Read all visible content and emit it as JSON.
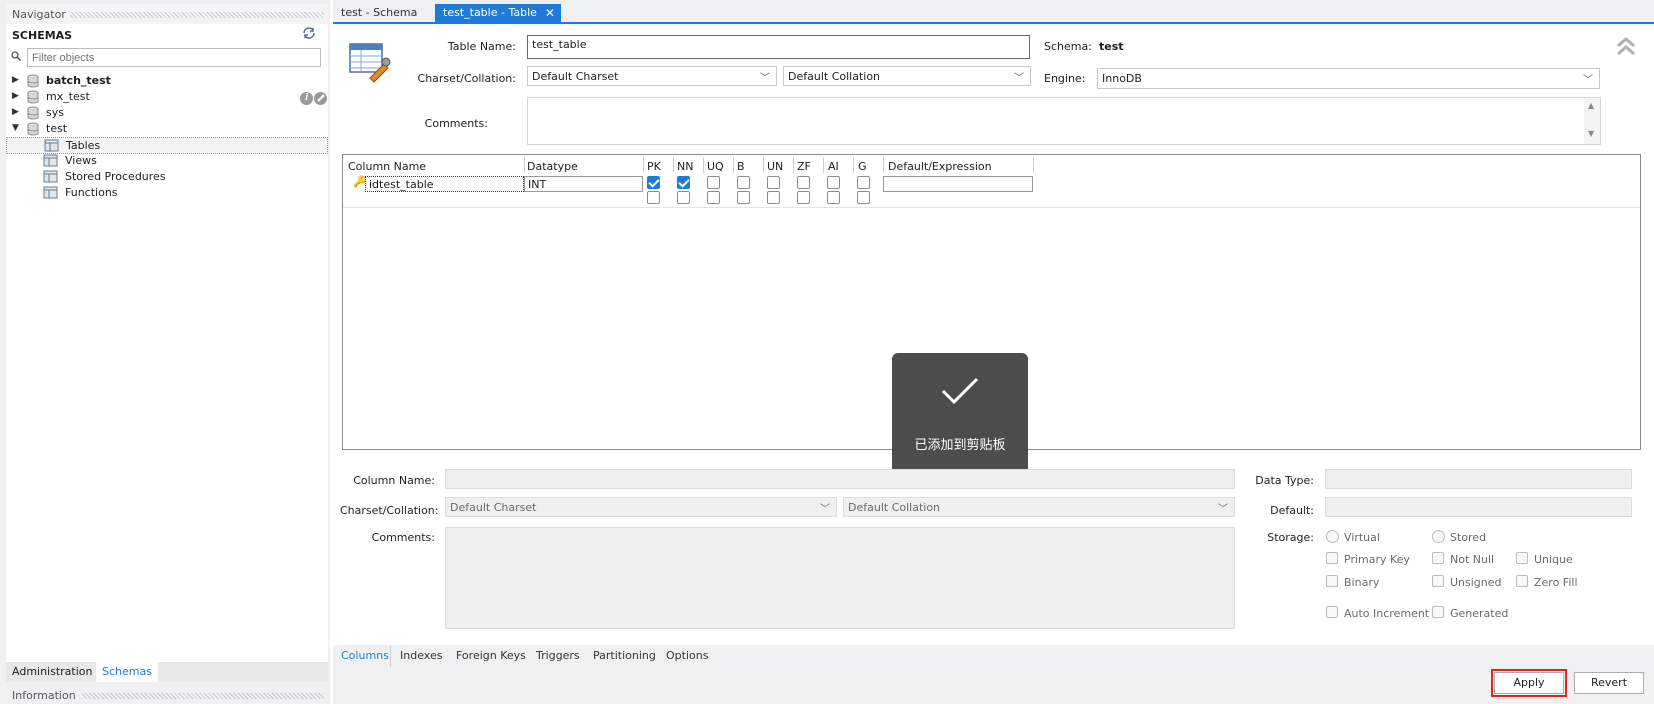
{
  "navigator": {
    "title": "Navigator",
    "schemas_header": "SCHEMAS",
    "filter_placeholder": "Filter objects",
    "schemas": [
      {
        "name": "batch_test"
      },
      {
        "name": "mx_test"
      },
      {
        "name": "sys"
      },
      {
        "name": "test"
      }
    ],
    "test_children": [
      "Tables",
      "Views",
      "Stored Procedures",
      "Functions"
    ],
    "tabs": [
      "Administration",
      "Schemas"
    ],
    "info_title": "Information"
  },
  "editor": {
    "tabs": [
      "test - Schema",
      "test_table - Table"
    ],
    "table_name_label": "Table Name:",
    "table_name_value": "test_table",
    "schema_label": "Schema:",
    "schema_value": "test",
    "charset_label": "Charset/Collation:",
    "charset_value": "Default Charset",
    "collation_value": "Default Collation",
    "engine_label": "Engine:",
    "engine_value": "InnoDB",
    "comments_label": "Comments:",
    "grid": {
      "headers": [
        "Column Name",
        "Datatype",
        "PK",
        "NN",
        "UQ",
        "B",
        "UN",
        "ZF",
        "AI",
        "G",
        "Default/Expression"
      ],
      "rows": [
        {
          "name": "idtest_table",
          "datatype": "INT",
          "flags": [
            true,
            true,
            false,
            false,
            false,
            false,
            false,
            false
          ]
        },
        {
          "name": "",
          "datatype": "",
          "flags": [
            false,
            false,
            false,
            false,
            false,
            false,
            false,
            false
          ]
        }
      ]
    },
    "toast": "已添加到剪贴板",
    "details": {
      "column_name_label": "Column Name:",
      "charset_label": "Charset/Collation:",
      "charset_value": "Default Charset",
      "collation_value": "Default Collation",
      "comments_label": "Comments:",
      "data_type_label": "Data Type:",
      "default_label": "Default:",
      "storage_label": "Storage:",
      "virtual": "Virtual",
      "stored": "Stored",
      "primary_key": "Primary Key",
      "not_null": "Not Null",
      "unique": "Unique",
      "binary": "Binary",
      "unsigned": "Unsigned",
      "zero_fill": "Zero Fill",
      "auto_increment": "Auto Increment",
      "generated": "Generated"
    },
    "bottom_tabs": [
      "Columns",
      "Indexes",
      "Foreign Keys",
      "Triggers",
      "Partitioning",
      "Options"
    ],
    "apply": "Apply",
    "revert": "Revert",
    "colors": {
      "accent": "#1f7bd8",
      "highlight": "#e02424"
    }
  }
}
